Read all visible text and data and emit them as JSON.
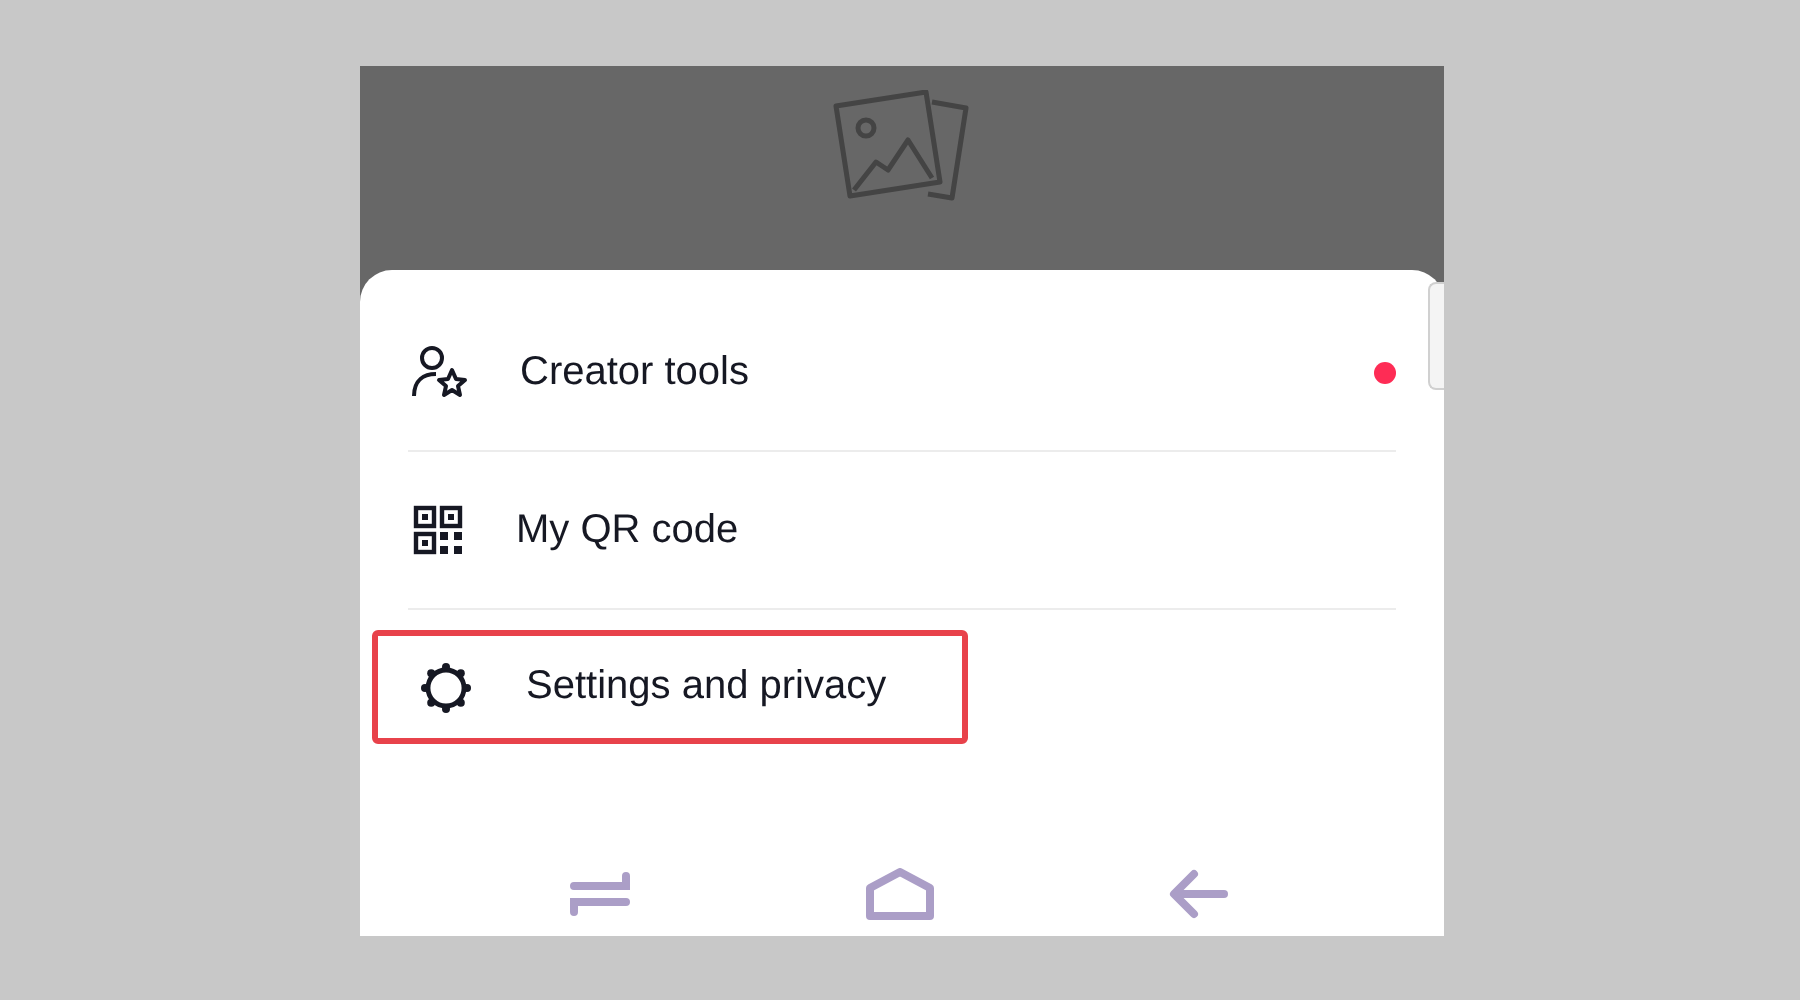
{
  "menu": {
    "items": [
      {
        "label": "Creator tools",
        "notification_dot": true,
        "highlighted": false
      },
      {
        "label": "My QR code",
        "notification_dot": false,
        "highlighted": false
      },
      {
        "label": "Settings and privacy",
        "notification_dot": false,
        "highlighted": true
      }
    ]
  }
}
